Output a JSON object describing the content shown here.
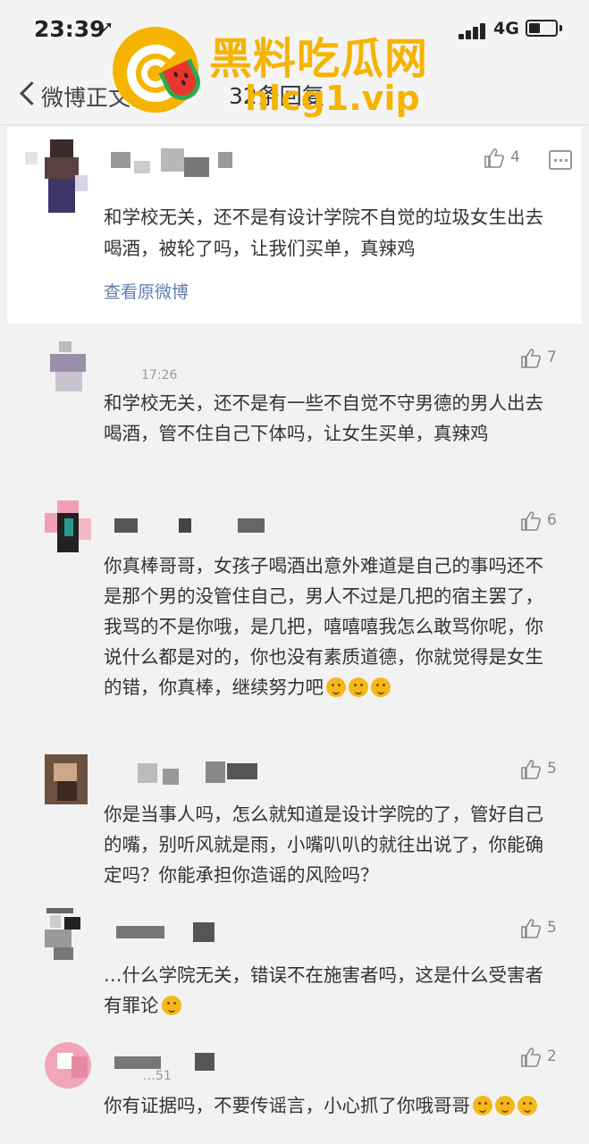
{
  "status_bar": {
    "time": "23:39",
    "location_icon": "location-arrow-icon",
    "network": "4G"
  },
  "nav": {
    "back_label": "微博正文",
    "title": "32条回复"
  },
  "watermark": {
    "brand": "黑料吃瓜网",
    "url": "hlcg1.vip",
    "color": "#f5b400"
  },
  "original": {
    "text": "和学校无关，还不是有设计学院不自觉的垃圾女生出去喝酒，被轮了吗，让我们买单，真辣鸡",
    "view_original": "查看原微博",
    "likes": "4"
  },
  "comments": [
    {
      "time": "17:26",
      "likes": "7",
      "text": "和学校无关，还不是有一些不自觉不守男德的男人出去喝酒，管不住自己下体吗，让女生买单，真辣鸡"
    },
    {
      "likes": "6",
      "text": "你真棒哥哥，女孩子喝酒出意外难道是自己的事吗还不是那个男的没管住自己，男人不过是几把的宿主罢了，我骂的不是你哦，是几把，嘻嘻嘻我怎么敢骂你呢，你说什么都是对的，你也没有素质道德，你就觉得是女生的错，你真棒，继续努力吧"
    },
    {
      "likes": "5",
      "text": "你是当事人吗，怎么就知道是设计学院的了，管好自己的嘴，别听风就是雨，小嘴叭叭的就往出说了，你能确定吗？你能承担你造谣的风险吗？"
    },
    {
      "likes": "5",
      "text": "…什么学院无关，错误不在施害者吗，这是什么受害者有罪论"
    },
    {
      "time": "…51",
      "likes": "2",
      "text": "你有证据吗，不要传谣言，小心抓了你哦哥哥"
    }
  ],
  "icons": {
    "like": "thumbs-up-icon",
    "comment": "comment-icon",
    "back": "chevron-left-icon",
    "emoji": "emoji-icon"
  }
}
